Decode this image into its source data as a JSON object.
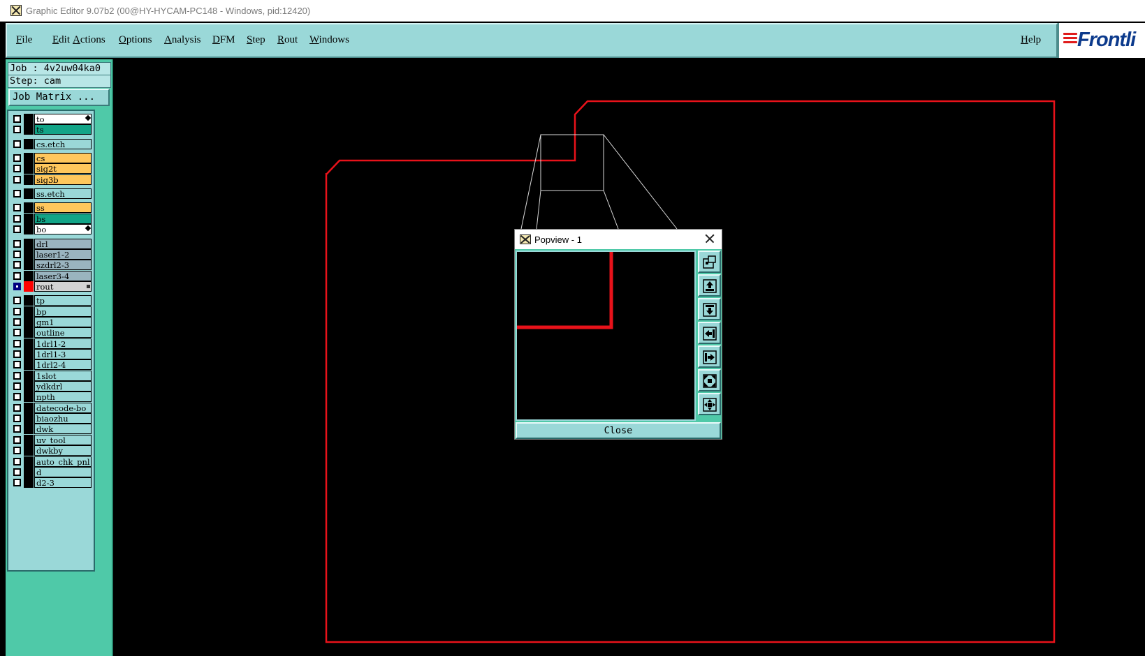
{
  "window": {
    "title": "Graphic Editor 9.07b2 (00@HY-HYCAM-PC148 - Windows, pid:12420)"
  },
  "menu": {
    "items": [
      "File",
      "Edit",
      "Actions",
      "Options",
      "Analysis",
      "DFM",
      "Step",
      "Rout",
      "Windows"
    ],
    "help": "Help"
  },
  "logo": {
    "text": "Frontli"
  },
  "job_panel": {
    "job": "Job : 4v2uw04ka0",
    "step": "Step: cam",
    "job_matrix_button": "Job Matrix ..."
  },
  "layers": [
    {
      "name": "to",
      "color": "#ffffff",
      "marker": "arrow"
    },
    {
      "name": "ts",
      "color": "#12a487"
    },
    {
      "name": "cs.etch",
      "color": "#9ad8d8",
      "group_gap": true
    },
    {
      "name": "cs",
      "color": "#ffc75c",
      "group_gap": true
    },
    {
      "name": "sig2t",
      "color": "#ffc75c"
    },
    {
      "name": "sig3b",
      "color": "#ffc75c"
    },
    {
      "name": "ss.etch",
      "color": "#9ad8d8",
      "group_gap": true
    },
    {
      "name": "ss",
      "color": "#ffc75c",
      "group_gap": true
    },
    {
      "name": "bs",
      "color": "#12a487"
    },
    {
      "name": "bo",
      "color": "#ffffff",
      "marker": "arrow"
    },
    {
      "name": "drl",
      "color": "#9ab4bf",
      "group_gap": true
    },
    {
      "name": "laser1-2",
      "color": "#9ab4bf"
    },
    {
      "name": "szdrl2-3",
      "color": "#9ab4bf"
    },
    {
      "name": "laser3-4",
      "color": "#9ab4bf"
    },
    {
      "name": "rout",
      "color": "#d3d3d3",
      "active": true,
      "swatch": "#ff0000",
      "marker": "dot"
    },
    {
      "name": "tp",
      "color": "#9ad8d8",
      "group_gap": true
    },
    {
      "name": "bp",
      "color": "#9ad8d8"
    },
    {
      "name": "gm1",
      "color": "#9ad8d8"
    },
    {
      "name": "outline",
      "color": "#9ad8d8"
    },
    {
      "name": "1drl1-2",
      "color": "#9ad8d8"
    },
    {
      "name": "1drl1-3",
      "color": "#9ad8d8"
    },
    {
      "name": "1drl2-4",
      "color": "#9ad8d8"
    },
    {
      "name": "1slot",
      "color": "#9ad8d8"
    },
    {
      "name": "ydkdrl",
      "color": "#9ad8d8"
    },
    {
      "name": "npth",
      "color": "#9ad8d8"
    },
    {
      "name": "datecode-bo",
      "color": "#9ad8d8"
    },
    {
      "name": "biaozhu",
      "color": "#9ad8d8"
    },
    {
      "name": "dwk",
      "color": "#9ad8d8"
    },
    {
      "name": "uv_tool",
      "color": "#9ad8d8"
    },
    {
      "name": "dwkby",
      "color": "#9ad8d8"
    },
    {
      "name": "auto_chk_pnl",
      "color": "#9ad8d8"
    },
    {
      "name": "d",
      "color": "#9ad8d8"
    },
    {
      "name": "d2-3",
      "color": "#9ad8d8"
    }
  ],
  "popview": {
    "title": "Popview - 1",
    "close_button": "Close",
    "tools": [
      "zoom-window-icon",
      "pan-up-icon",
      "pan-down-icon",
      "pan-left-icon",
      "pan-right-icon",
      "zoom-in-icon",
      "zoom-out-icon"
    ]
  },
  "colors": {
    "panel_teal": "#9ad8d8",
    "panel_green": "#4fc9a8",
    "rout_outline": "#e8121a"
  }
}
